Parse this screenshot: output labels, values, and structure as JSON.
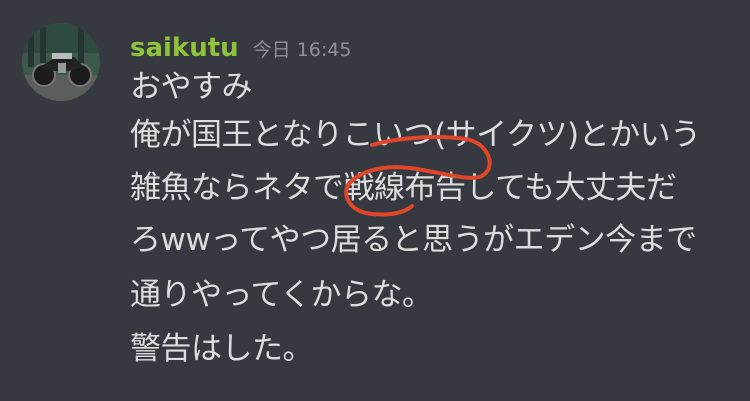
{
  "message": {
    "author": "saikutu",
    "timestamp": "今日 16:45",
    "lines": [
      "おやすみ",
      "俺が国王となりこいつ(サイクツ)とかいう",
      "雑魚ならネタで戦線布告しても大丈夫だ",
      "ろwwってやつ居ると思うがエデン今まで",
      "通りやってくからな。",
      "警告はした。"
    ]
  },
  "colors": {
    "background": "#36393f",
    "username": "#8fc43a",
    "text": "#dcddde",
    "timestamp": "#8e9297",
    "annotation": "#e0462a"
  },
  "icons": {
    "avatar": "motorcycle-avatar"
  }
}
